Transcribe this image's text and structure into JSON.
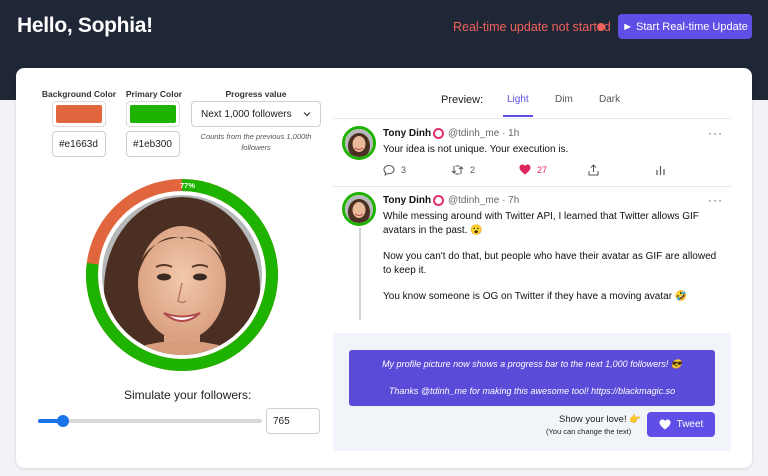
{
  "header": {
    "greeting": "Hello, Sophia!",
    "realtime_status": "Real-time update not started",
    "realtime_button": "► Start Real-time Update",
    "status_color": "#f0625a",
    "accent": "#5f4fe6"
  },
  "controls": {
    "background_label": "Background Color",
    "primary_label": "Primary Color",
    "progress_label": "Progress value",
    "background_hex": "#e1663d",
    "primary_hex": "#1eb300",
    "progress_selected": "Next 1,000 followers",
    "hint": "Counts from the previous 1,000th followers"
  },
  "avatar": {
    "progress_percent": 77,
    "progress_label": "77%"
  },
  "simulate": {
    "label": "Simulate your followers:",
    "value": "765",
    "slider_fraction": 0.11
  },
  "preview": {
    "label": "Preview:",
    "tabs": [
      "Light",
      "Dim",
      "Dark"
    ],
    "active_tab": "Light"
  },
  "tweets": [
    {
      "name": "Tony Dinh",
      "handle": "@tdinh_me · 1h",
      "text": "Your idea is not unique. Your execution is.",
      "replies": "3",
      "retweets": "2",
      "likes": "27"
    },
    {
      "name": "Tony Dinh",
      "handle": "@tdinh_me · 7h",
      "lines": [
        "While messing around with Twitter API, I learned that Twitter allows GIF",
        "avatars in the past. 😮",
        "Now you can't do that, but people who have their avatar as GIF are allowed",
        "to keep it.",
        "You know someone is OG on Twitter if they have a moving avatar 🤣"
      ]
    }
  ],
  "compose": {
    "line1": "My profile picture now shows a progress bar to the next 1,000 followers! 😎",
    "line2": "Thanks @tdinh_me for making this awesome tool! https://blackmagic.so",
    "love": "Show your love! 👉",
    "change": "(You can change the text)",
    "tweet_button": "Tweet"
  }
}
